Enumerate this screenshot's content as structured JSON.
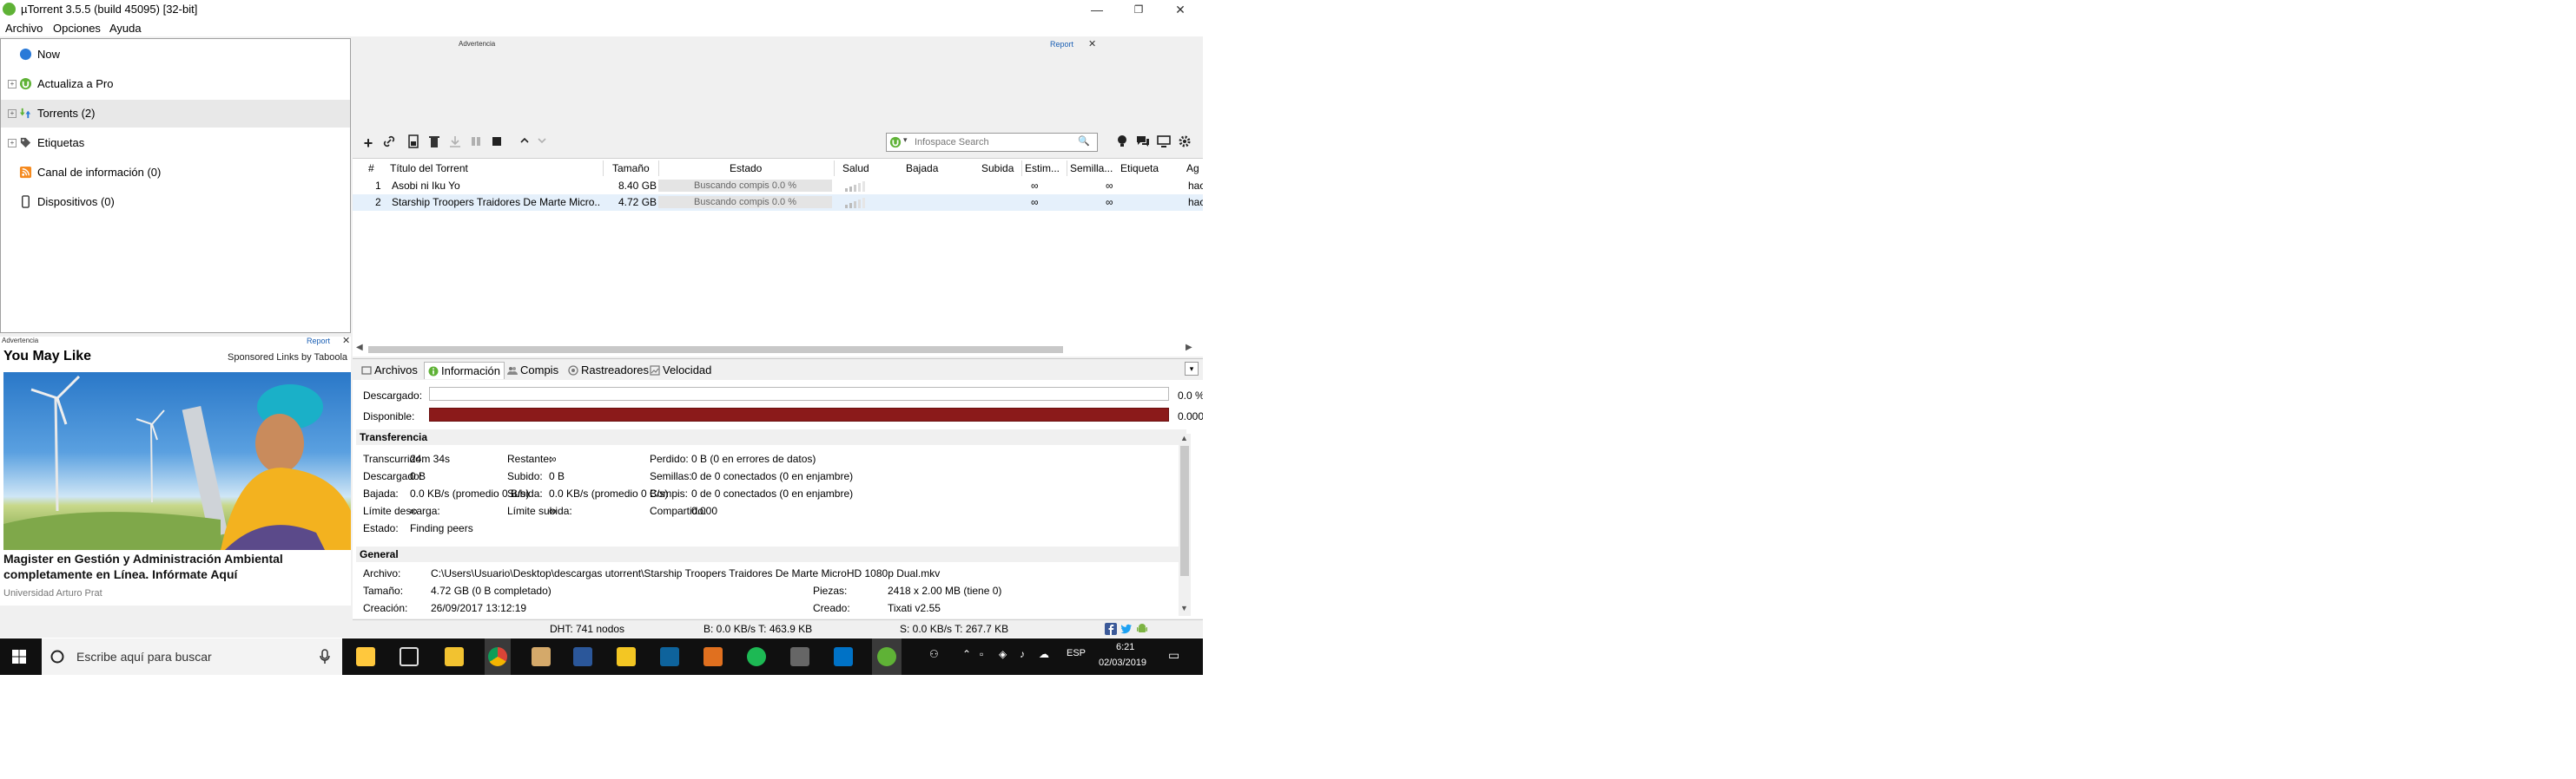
{
  "window": {
    "title": "µTorrent 3.5.5  (build 45095) [32-bit]",
    "minimize": "—",
    "restore": "❐",
    "close": "✕"
  },
  "menu": [
    "Archivo",
    "Opciones",
    "Ayuda"
  ],
  "sidebar": {
    "items": [
      {
        "label": "Now"
      },
      {
        "label": "Actualiza a Pro"
      },
      {
        "label": "Torrents (2)"
      },
      {
        "label": "Etiquetas"
      },
      {
        "label": "Canal de información (0)"
      },
      {
        "label": "Dispositivos (0)"
      }
    ]
  },
  "left_ad": {
    "advert": "Advertencia",
    "report": "Report",
    "close": "✕",
    "heading": "You May Like",
    "sponsor": "Sponsored Links by Taboola",
    "headline": "Magister en Gestión y Administración Ambiental completamente en Línea. Infórmate Aquí",
    "source": "Universidad Arturo Prat"
  },
  "top_ad": {
    "advert": "Advertencia",
    "report": "Report",
    "close": "✕"
  },
  "toolbar": {
    "search_placeholder": "Infospace Search",
    "search_btn": "🔍"
  },
  "columns": [
    "#",
    "Título del Torrent",
    "Tamaño",
    "Estado",
    "Salud",
    "Bajada",
    "Subida",
    "Estim...",
    "Semilla...",
    "Etiqueta",
    "Ag"
  ],
  "torrents": [
    {
      "num": "1",
      "name": "Asobi ni Iku Yo",
      "size": "8.40 GB",
      "status": "Buscando compis 0.0 %",
      "eta": "∞",
      "seeds": "∞",
      "added": "hac"
    },
    {
      "num": "2",
      "name": "Starship Troopers Traidores De Marte Micro...",
      "size": "4.72 GB",
      "status": "Buscando compis 0.0 %",
      "eta": "∞",
      "seeds": "∞",
      "added": "hac"
    }
  ],
  "tabs": [
    "Archivos",
    "Información",
    "Compis",
    "Rastreadores",
    "Velocidad"
  ],
  "info": {
    "downloaded_label": "Descargado:",
    "downloaded_pct": "0.0 %",
    "downloaded_fraction": 0.0,
    "available_label": "Disponible:",
    "available_val": "0.000",
    "transfer_header": "Transferencia",
    "transfer": [
      [
        {
          "l": "Transcurrido:",
          "v": "24m 34s"
        },
        {
          "l": "Restante:",
          "v": "∞"
        },
        {
          "l": "Perdido:",
          "v": "0 B (0 en errores de datos)"
        }
      ],
      [
        {
          "l": "Descargado:",
          "v": "0 B"
        },
        {
          "l": "Subido:",
          "v": "0 B"
        },
        {
          "l": "Semillas:",
          "v": "0 de 0 conectados (0 en enjambre)"
        }
      ],
      [
        {
          "l": "Bajada:",
          "v": "0.0 KB/s (promedio 0 B/s)"
        },
        {
          "l": "Subida:",
          "v": "0.0 KB/s (promedio 0 B/s)"
        },
        {
          "l": "Compis:",
          "v": "0 de 0 conectados (0 en enjambre)"
        }
      ],
      [
        {
          "l": "Límite descarga:",
          "v": "∞"
        },
        {
          "l": "Límite subida:",
          "v": "∞"
        },
        {
          "l": "Compartido:",
          "v": "0.000"
        }
      ],
      [
        {
          "l": "Estado:",
          "v": "Finding peers"
        }
      ]
    ],
    "general_header": "General",
    "general": {
      "file_l": "Archivo:",
      "file_v": "C:\\Users\\Usuario\\Desktop\\descargas utorrent\\Starship Troopers Traidores De Marte MicroHD 1080p Dual.mkv",
      "size_l": "Tamaño:",
      "size_v": "4.72 GB (0 B completado)",
      "pieces_l": "Piezas:",
      "pieces_v": "2418 x 2.00 MB (tiene 0)",
      "created_l": "Creación:",
      "created_v": "26/09/2017 13:12:19",
      "createdby_l": "Creado:",
      "createdby_v": "Tixati v2.55"
    }
  },
  "statusbar": {
    "dht": "DHT: 741 nodos",
    "down": "B: 0.0 KB/s T: 463.9 KB",
    "up": "S: 0.0 KB/s T: 267.7 KB"
  },
  "taskbar": {
    "search_placeholder": "Escribe aquí para buscar",
    "time": "6:21",
    "date": "02/03/2019",
    "lang": "ESP"
  },
  "colors": {
    "available_bar": "#8b1a1a",
    "utorrent_green": "#5fb236",
    "selection": "#e5f0fb"
  }
}
